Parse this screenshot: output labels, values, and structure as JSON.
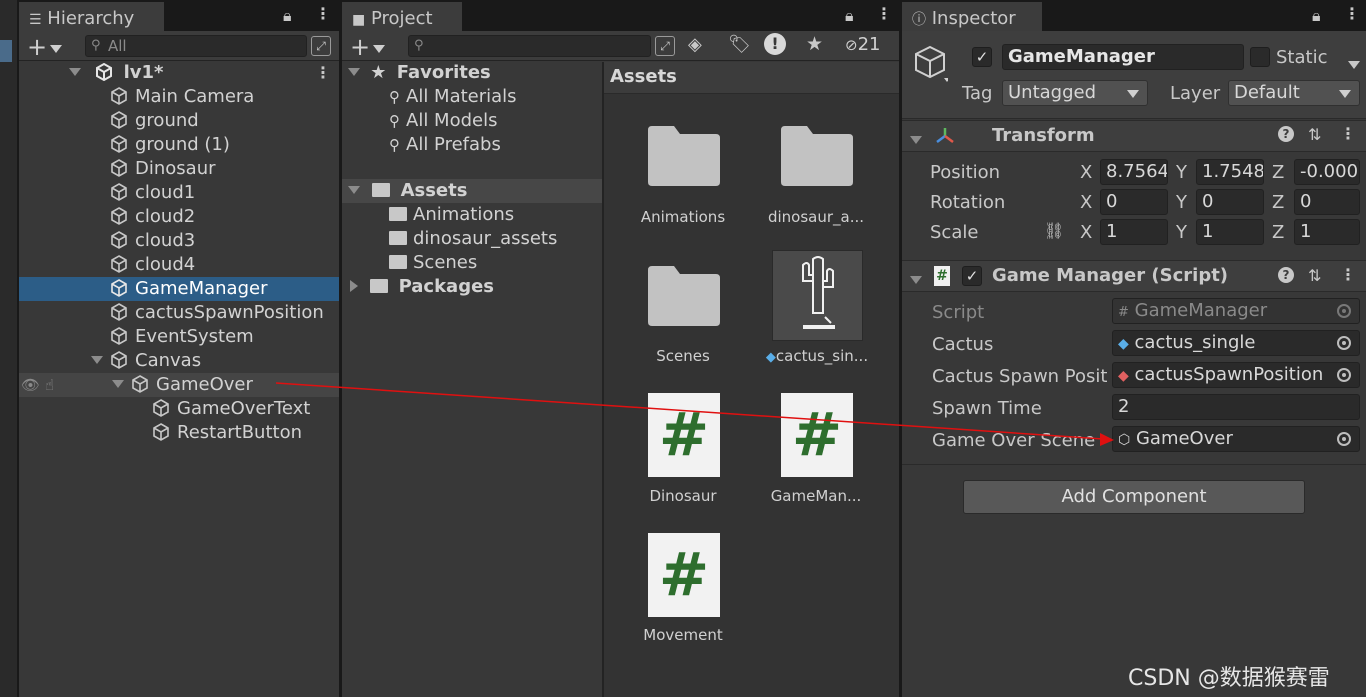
{
  "hierarchy": {
    "tab_label": "Hierarchy",
    "search_placeholder": "All",
    "add_symbol": "+",
    "scene_name": "lv1*",
    "items": [
      {
        "label": "Main Camera"
      },
      {
        "label": "ground"
      },
      {
        "label": "ground (1)"
      },
      {
        "label": "Dinosaur"
      },
      {
        "label": "cloud1"
      },
      {
        "label": "cloud2"
      },
      {
        "label": "cloud3"
      },
      {
        "label": "cloud4"
      },
      {
        "label": "GameManager"
      },
      {
        "label": "cactusSpawnPosition"
      },
      {
        "label": "EventSystem"
      },
      {
        "label": "Canvas"
      },
      {
        "label": "GameOver"
      },
      {
        "label": "GameOverText"
      },
      {
        "label": "RestartButton"
      }
    ]
  },
  "project": {
    "tab_label": "Project",
    "add_symbol": "+",
    "hidden_count": "21",
    "favorites_label": "Favorites",
    "favorites": [
      "All Materials",
      "All Models",
      "All Prefabs"
    ],
    "assets_label": "Assets",
    "asset_folders": [
      "Animations",
      "dinosaur_assets",
      "Scenes"
    ],
    "packages_label": "Packages",
    "breadcrumb": "Assets",
    "grid_items": [
      {
        "label": "Animations",
        "kind": "folder"
      },
      {
        "label": "dinosaur_a...",
        "kind": "folder"
      },
      {
        "label": "Scenes",
        "kind": "folder"
      },
      {
        "label": "cactus_sin...",
        "kind": "prefab"
      },
      {
        "label": "Dinosaur",
        "kind": "script"
      },
      {
        "label": "GameMan...",
        "kind": "script"
      },
      {
        "label": "Movement",
        "kind": "script"
      }
    ]
  },
  "inspector": {
    "tab_label": "Inspector",
    "object_name": "GameManager",
    "static_label": "Static",
    "tag_label": "Tag",
    "tag_value": "Untagged",
    "layer_label": "Layer",
    "layer_value": "Default",
    "transform": {
      "title": "Transform",
      "position_label": "Position",
      "rotation_label": "Rotation",
      "scale_label": "Scale",
      "position": {
        "x": "8.7564",
        "y": "1.7548",
        "z": "-0.000"
      },
      "rotation": {
        "x": "0",
        "y": "0",
        "z": "0"
      },
      "scale": {
        "x": "1",
        "y": "1",
        "z": "1"
      }
    },
    "axis_labels": {
      "x": "X",
      "y": "Y",
      "z": "Z"
    },
    "script_component": {
      "title": "Game Manager (Script)",
      "script_label": "Script",
      "script_value": "GameManager",
      "cactus_label": "Cactus",
      "cactus_value": "cactus_single",
      "spawn_pos_label": "Cactus Spawn Posit",
      "spawn_pos_value": "cactusSpawnPosition",
      "spawn_time_label": "Spawn Time",
      "spawn_time_value": "2",
      "game_over_label": "Game Over Scene",
      "game_over_value": "GameOver"
    },
    "add_component_label": "Add Component"
  },
  "watermark": "CSDN @数据猴赛雷",
  "colors": {
    "selection": "#2c5d87",
    "annotation_arrow": "#e01010",
    "script_hash": "#2e6e2e"
  }
}
